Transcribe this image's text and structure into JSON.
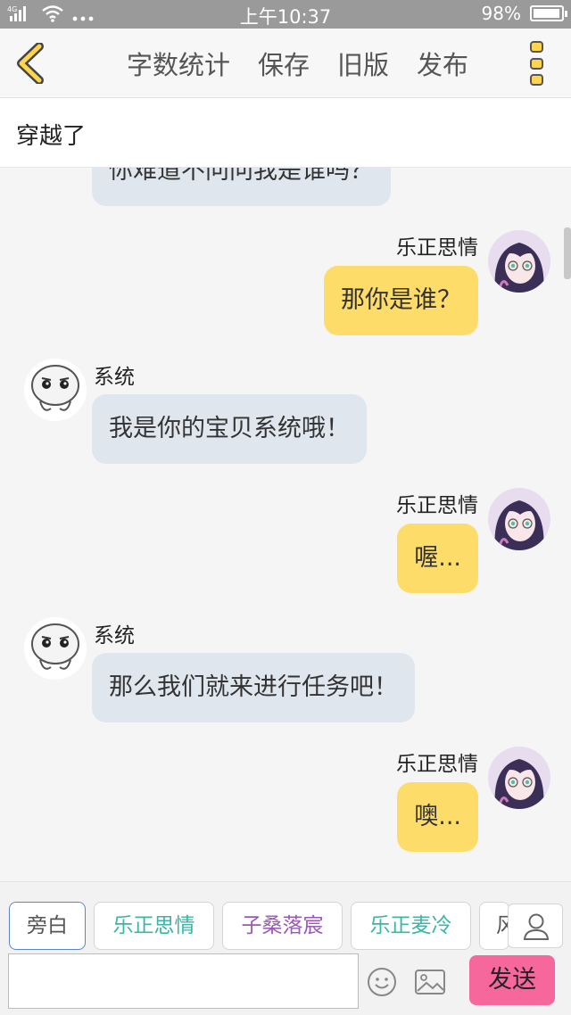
{
  "status_bar": {
    "network": "4G",
    "time": "上午10:37",
    "battery": "98%",
    "battery_level": 0.98
  },
  "top_bar": {
    "actions": [
      "字数统计",
      "保存",
      "旧版",
      "发布"
    ]
  },
  "title": "穿越了",
  "messages": [
    {
      "side": "left",
      "name": "",
      "text": "你难道不问问我是谁吗？"
    },
    {
      "side": "right",
      "name": "乐正思情",
      "text": "那你是谁？"
    },
    {
      "side": "left",
      "name": "系统",
      "text": "我是你的宝贝系统哦！"
    },
    {
      "side": "right",
      "name": "乐正思情",
      "text": "喔..."
    },
    {
      "side": "left",
      "name": "系统",
      "text": "那么我们就来进行任务吧！"
    },
    {
      "side": "right",
      "name": "乐正思情",
      "text": "噢..."
    }
  ],
  "characters": [
    {
      "label": "旁白",
      "color": "#555555",
      "active": true
    },
    {
      "label": "乐正思情",
      "color": "#3ab5a6",
      "active": false
    },
    {
      "label": "子桑落宸",
      "color": "#9b59b6",
      "active": false
    },
    {
      "label": "乐正麦冷",
      "color": "#3ab5a6",
      "active": false
    },
    {
      "label": "风",
      "color": "#555555",
      "active": false
    }
  ],
  "input": {
    "value": "",
    "placeholder": ""
  },
  "send_label": "发送",
  "colors": {
    "bubble_left": "#dfe6ee",
    "bubble_right": "#fedc69",
    "send_button": "#f6679c"
  }
}
